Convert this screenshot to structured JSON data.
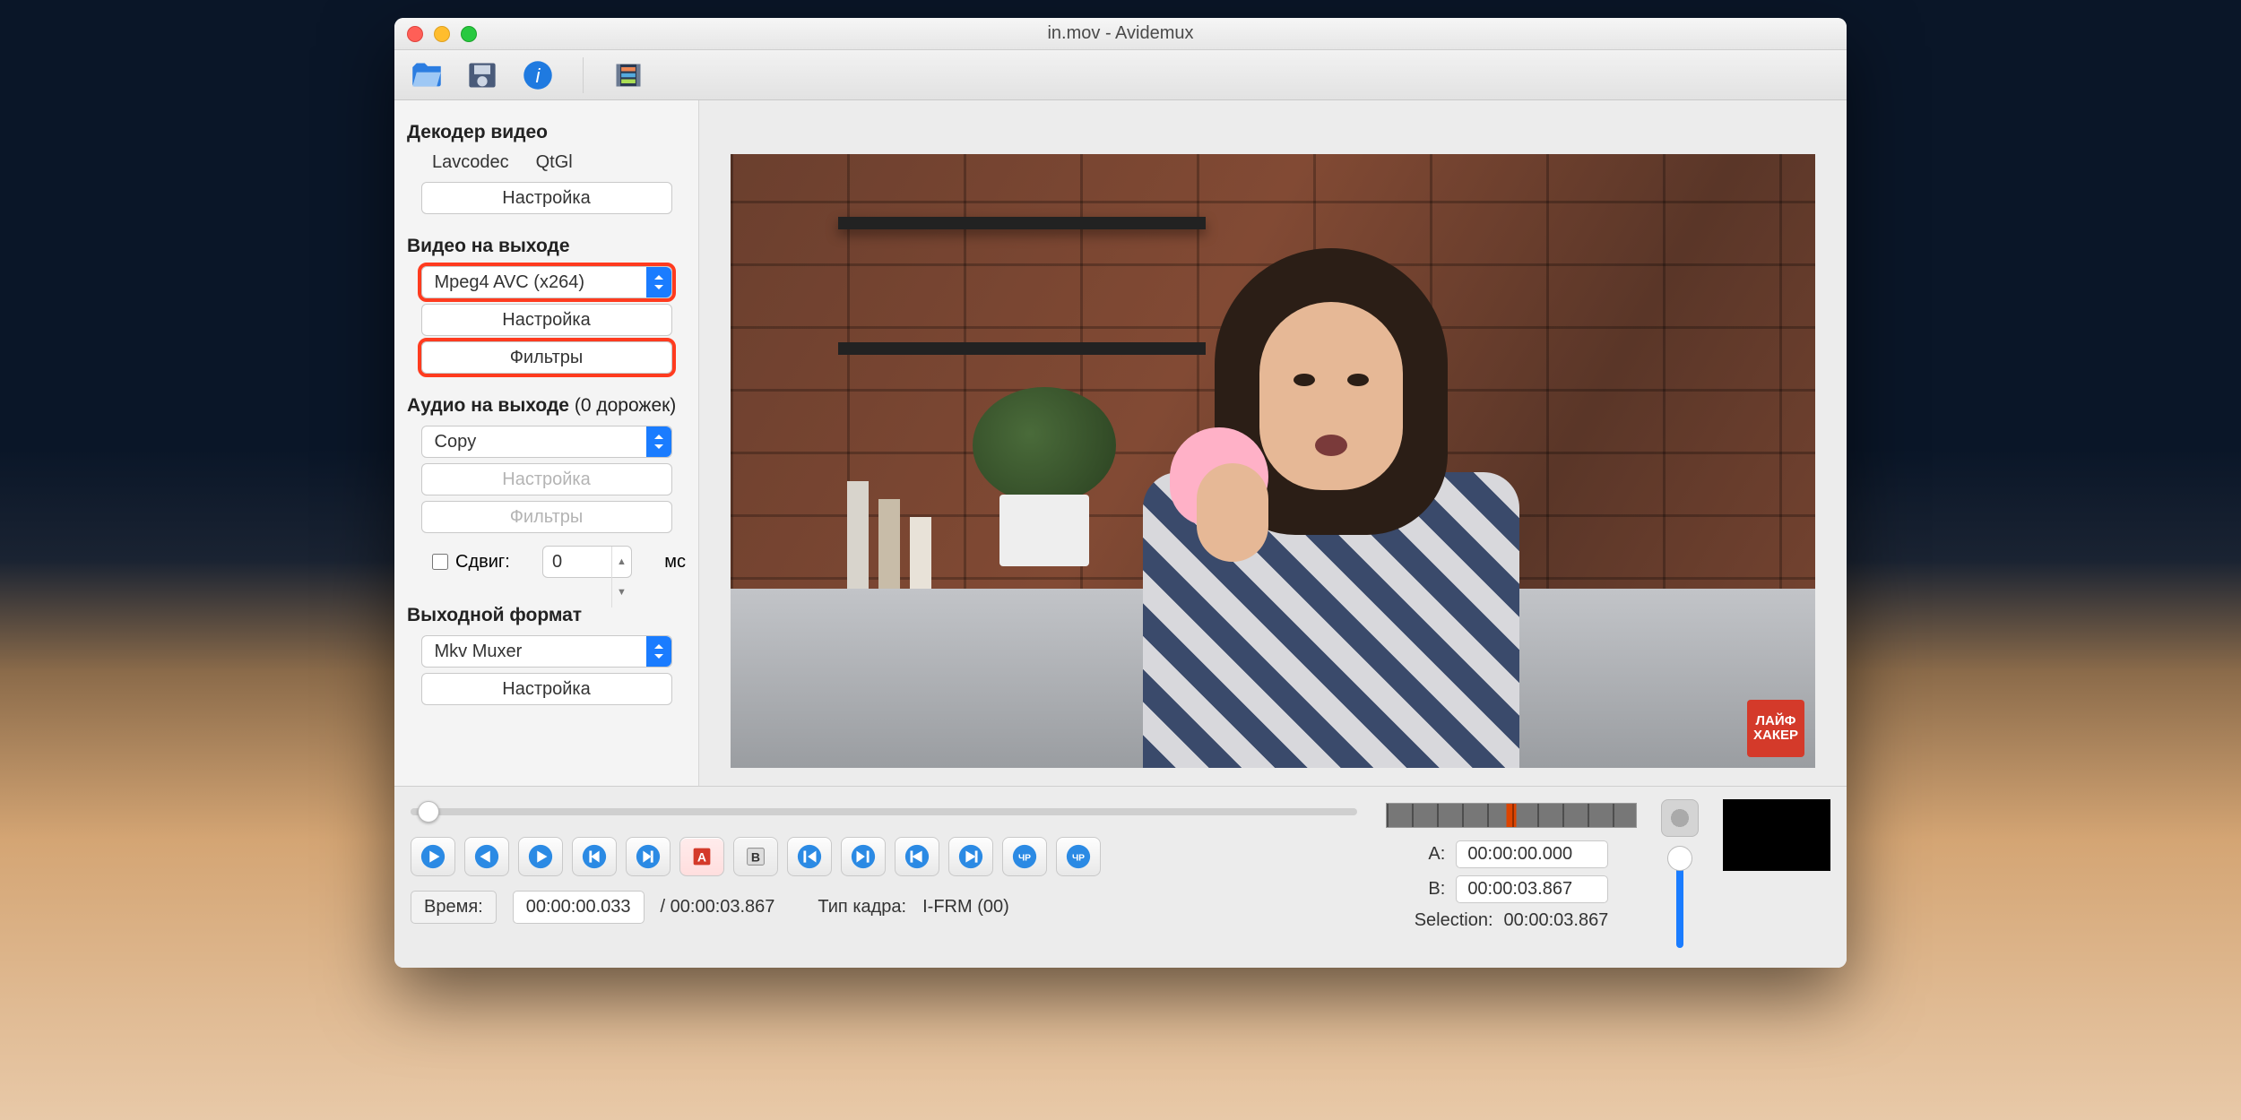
{
  "window": {
    "title": "in.mov - Avidemux"
  },
  "toolbar": {
    "icons": [
      "open-icon",
      "save-icon",
      "info-icon",
      "filter-icon"
    ]
  },
  "decoder": {
    "heading": "Декодер видео",
    "chip1": "Lavcodec",
    "chip2": "QtGl",
    "settings_btn": "Настройка"
  },
  "video_out": {
    "heading": "Видео на выходе",
    "codec_select": "Mpeg4 AVC (x264)",
    "settings_btn": "Настройка",
    "filters_btn": "Фильтры"
  },
  "audio_out": {
    "heading": "Аудио на выходе",
    "tracks_suffix": "(0 дорожек)",
    "codec_select": "Copy",
    "settings_btn": "Настройка",
    "filters_btn": "Фильтры",
    "shift_label": "Сдвиг:",
    "shift_value": "0",
    "shift_unit": "мс"
  },
  "output_format": {
    "heading": "Выходной формат",
    "container_select": "Mkv Muxer",
    "settings_btn": "Настройка"
  },
  "preview_badge": "ЛАЙФ\nХАКЕР",
  "transport": {
    "time_label": "Время:",
    "time_value": "00:00:00.033",
    "duration_prefix": "/ ",
    "duration": "00:00:03.867",
    "frame_type_label": "Тип кадра:",
    "frame_type_value": "I-FRM (00)"
  },
  "selection": {
    "a_label": "A:",
    "a_value": "00:00:00.000",
    "b_label": "B:",
    "b_value": "00:00:03.867",
    "sel_label": "Selection:",
    "sel_value": "00:00:03.867"
  }
}
